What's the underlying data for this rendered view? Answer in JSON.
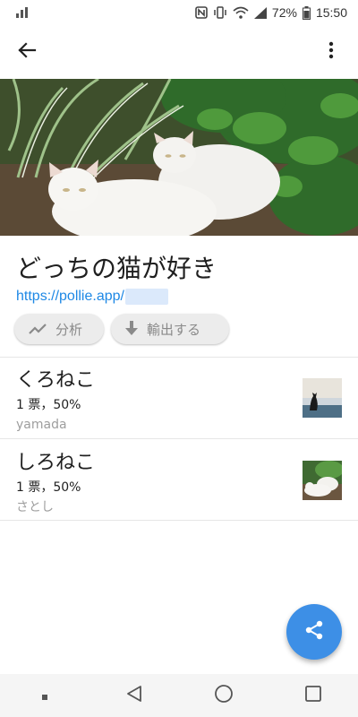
{
  "status_bar": {
    "battery_percent": "72%",
    "time": "15:50",
    "icons": [
      "signal-bars-icon",
      "nfc-icon",
      "vibrate-icon",
      "wifi-icon",
      "cell-signal-icon",
      "battery-icon"
    ]
  },
  "app_bar": {
    "back_icon": "arrow-back-icon",
    "menu_icon": "more-vert-icon"
  },
  "poll": {
    "title": "どっちの猫が好き",
    "link": "https://pollie.app/"
  },
  "actions": {
    "analyze_label": "分析",
    "export_label": "輸出する"
  },
  "options": [
    {
      "label": "くろねこ",
      "stats": "1 票，50%",
      "user": "yamada"
    },
    {
      "label": "しろねこ",
      "stats": "1 票，50%",
      "user": "さとし"
    }
  ],
  "fab": {
    "icon": "share-icon"
  },
  "nav": {
    "icons": [
      "recent-dot-icon",
      "back-triangle-icon",
      "home-circle-icon",
      "overview-square-icon"
    ]
  },
  "colors": {
    "accent": "#3d8fe6",
    "link": "#1e88e5",
    "chip_bg": "#ececec"
  }
}
